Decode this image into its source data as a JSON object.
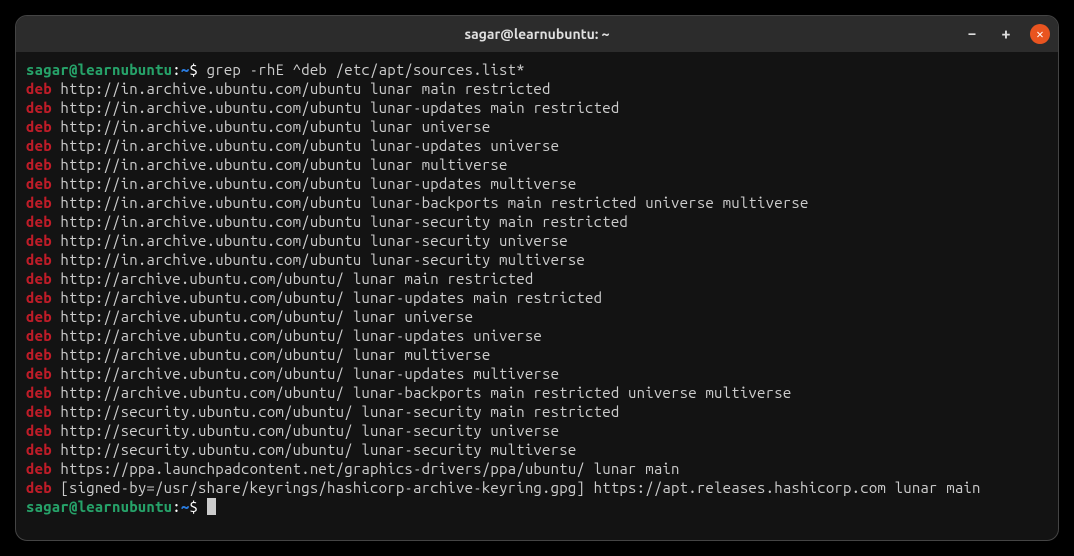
{
  "window": {
    "title": "sagar@learnubuntu: ~"
  },
  "prompt": {
    "user_host": "sagar@learnubuntu",
    "colon": ":",
    "path": "~",
    "symbol": "$"
  },
  "command": "grep -rhE ^deb /etc/apt/sources.list*",
  "lines": [
    {
      "match": "deb",
      "rest": " http://in.archive.ubuntu.com/ubuntu lunar main restricted"
    },
    {
      "match": "deb",
      "rest": " http://in.archive.ubuntu.com/ubuntu lunar-updates main restricted"
    },
    {
      "match": "deb",
      "rest": " http://in.archive.ubuntu.com/ubuntu lunar universe"
    },
    {
      "match": "deb",
      "rest": " http://in.archive.ubuntu.com/ubuntu lunar-updates universe"
    },
    {
      "match": "deb",
      "rest": " http://in.archive.ubuntu.com/ubuntu lunar multiverse"
    },
    {
      "match": "deb",
      "rest": " http://in.archive.ubuntu.com/ubuntu lunar-updates multiverse"
    },
    {
      "match": "deb",
      "rest": " http://in.archive.ubuntu.com/ubuntu lunar-backports main restricted universe multiverse"
    },
    {
      "match": "deb",
      "rest": " http://in.archive.ubuntu.com/ubuntu lunar-security main restricted"
    },
    {
      "match": "deb",
      "rest": " http://in.archive.ubuntu.com/ubuntu lunar-security universe"
    },
    {
      "match": "deb",
      "rest": " http://in.archive.ubuntu.com/ubuntu lunar-security multiverse"
    },
    {
      "match": "deb",
      "rest": " http://archive.ubuntu.com/ubuntu/ lunar main restricted"
    },
    {
      "match": "deb",
      "rest": " http://archive.ubuntu.com/ubuntu/ lunar-updates main restricted"
    },
    {
      "match": "deb",
      "rest": " http://archive.ubuntu.com/ubuntu/ lunar universe"
    },
    {
      "match": "deb",
      "rest": " http://archive.ubuntu.com/ubuntu/ lunar-updates universe"
    },
    {
      "match": "deb",
      "rest": " http://archive.ubuntu.com/ubuntu/ lunar multiverse"
    },
    {
      "match": "deb",
      "rest": " http://archive.ubuntu.com/ubuntu/ lunar-updates multiverse"
    },
    {
      "match": "deb",
      "rest": " http://archive.ubuntu.com/ubuntu/ lunar-backports main restricted universe multiverse"
    },
    {
      "match": "deb",
      "rest": " http://security.ubuntu.com/ubuntu/ lunar-security main restricted"
    },
    {
      "match": "deb",
      "rest": " http://security.ubuntu.com/ubuntu/ lunar-security universe"
    },
    {
      "match": "deb",
      "rest": " http://security.ubuntu.com/ubuntu/ lunar-security multiverse"
    },
    {
      "match": "deb",
      "rest": " https://ppa.launchpadcontent.net/graphics-drivers/ppa/ubuntu/ lunar main"
    },
    {
      "match": "deb",
      "rest": " [signed-by=/usr/share/keyrings/hashicorp-archive-keyring.gpg] https://apt.releases.hashicorp.com lunar main"
    }
  ]
}
